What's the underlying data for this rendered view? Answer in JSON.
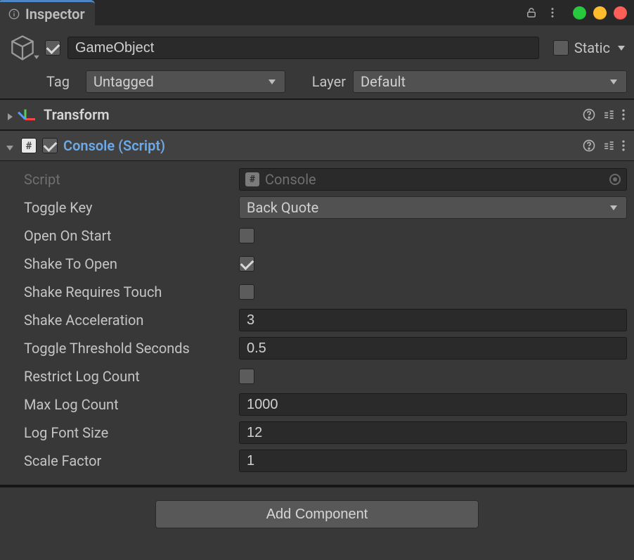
{
  "tab": {
    "title": "Inspector"
  },
  "go": {
    "enabled": true,
    "name": "GameObject",
    "static": {
      "label": "Static",
      "checked": false
    },
    "tag": {
      "label": "Tag",
      "value": "Untagged"
    },
    "layer": {
      "label": "Layer",
      "value": "Default"
    }
  },
  "transform": {
    "title": "Transform"
  },
  "console_component": {
    "title": "Console (Script)",
    "enabled": true,
    "script": {
      "label": "Script",
      "value": "Console"
    },
    "toggle_key": {
      "label": "Toggle Key",
      "value": "Back Quote"
    },
    "open_on_start": {
      "label": "Open On Start",
      "checked": false
    },
    "shake_to_open": {
      "label": "Shake To Open",
      "checked": true
    },
    "shake_requires_touch": {
      "label": "Shake Requires Touch",
      "checked": false
    },
    "shake_acceleration": {
      "label": "Shake Acceleration",
      "value": "3"
    },
    "toggle_threshold_seconds": {
      "label": "Toggle Threshold Seconds",
      "value": "0.5"
    },
    "restrict_log_count": {
      "label": "Restrict Log Count",
      "checked": false
    },
    "max_log_count": {
      "label": "Max Log Count",
      "value": "1000"
    },
    "log_font_size": {
      "label": "Log Font Size",
      "value": "12"
    },
    "scale_factor": {
      "label": "Scale Factor",
      "value": "1"
    }
  },
  "add_component_label": "Add Component"
}
